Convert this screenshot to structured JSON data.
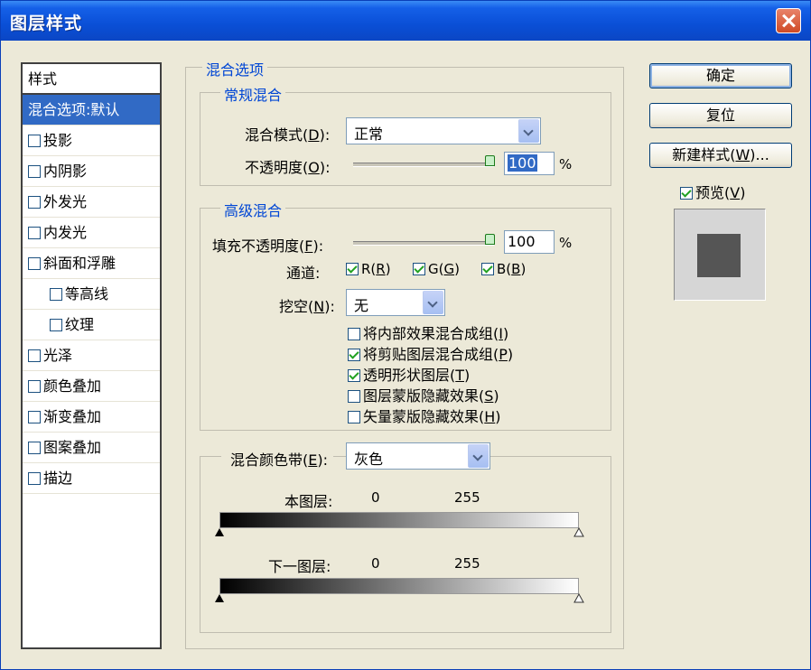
{
  "window": {
    "title": "图层样式"
  },
  "style_list": {
    "header": "样式",
    "items": [
      {
        "label": "混合选项:默认",
        "checkbox": false,
        "selected": true
      },
      {
        "label": "投影",
        "checkbox": true,
        "checked": false
      },
      {
        "label": "内阴影",
        "checkbox": true,
        "checked": false
      },
      {
        "label": "外发光",
        "checkbox": true,
        "checked": false
      },
      {
        "label": "内发光",
        "checkbox": true,
        "checked": false
      },
      {
        "label": "斜面和浮雕",
        "checkbox": true,
        "checked": false
      },
      {
        "label": "等高线",
        "checkbox": true,
        "checked": false,
        "sub": true
      },
      {
        "label": "纹理",
        "checkbox": true,
        "checked": false,
        "sub": true
      },
      {
        "label": "光泽",
        "checkbox": true,
        "checked": false
      },
      {
        "label": "颜色叠加",
        "checkbox": true,
        "checked": false
      },
      {
        "label": "渐变叠加",
        "checkbox": true,
        "checked": false
      },
      {
        "label": "图案叠加",
        "checkbox": true,
        "checked": false
      },
      {
        "label": "描边",
        "checkbox": true,
        "checked": false
      }
    ]
  },
  "blend_options": {
    "legend": "混合选项",
    "general": {
      "legend": "常规混合",
      "mode_label": "混合模式(",
      "mode_key": "D",
      "mode_value": "正常",
      "opacity_label": "不透明度(",
      "opacity_key": "O",
      "opacity_value": "100",
      "opacity_unit": "%"
    },
    "advanced": {
      "legend": "高级混合",
      "fill_label": "填充不透明度(",
      "fill_key": "F",
      "fill_value": "100",
      "fill_unit": "%",
      "channels_label": "通道:",
      "channels": [
        {
          "label": "R(",
          "key": "R",
          "checked": true
        },
        {
          "label": "G(",
          "key": "G",
          "checked": true
        },
        {
          "label": "B(",
          "key": "B",
          "checked": true
        }
      ],
      "knockout_label": "挖空(",
      "knockout_key": "N",
      "knockout_value": "无",
      "options": [
        {
          "label": "将内部效果混合成组(",
          "key": "I",
          "checked": false
        },
        {
          "label": "将剪贴图层混合成组(",
          "key": "P",
          "checked": true
        },
        {
          "label": "透明形状图层(",
          "key": "T",
          "checked": true
        },
        {
          "label": "图层蒙版隐藏效果(",
          "key": "S",
          "checked": false
        },
        {
          "label": "矢量蒙版隐藏效果(",
          "key": "H",
          "checked": false
        }
      ]
    },
    "blend_if": {
      "label": "混合颜色带(",
      "key": "E",
      "value": "灰色",
      "this_layer_label": "本图层:",
      "underlying_label": "下一图层:",
      "min": "0",
      "max": "255"
    }
  },
  "buttons": {
    "ok": "确定",
    "reset": "复位",
    "new_style": "新建样式(",
    "new_style_key": "W",
    "new_style_suffix": ")..."
  },
  "preview": {
    "label": "预览(",
    "key": "V",
    "checked": true
  },
  "colors": {
    "accent": "#316ac5",
    "legend_text": "#0046d5",
    "dialog_bg": "#ece9d8",
    "titlebar": "#0a4fd6",
    "preview_swatch": "#555555"
  }
}
